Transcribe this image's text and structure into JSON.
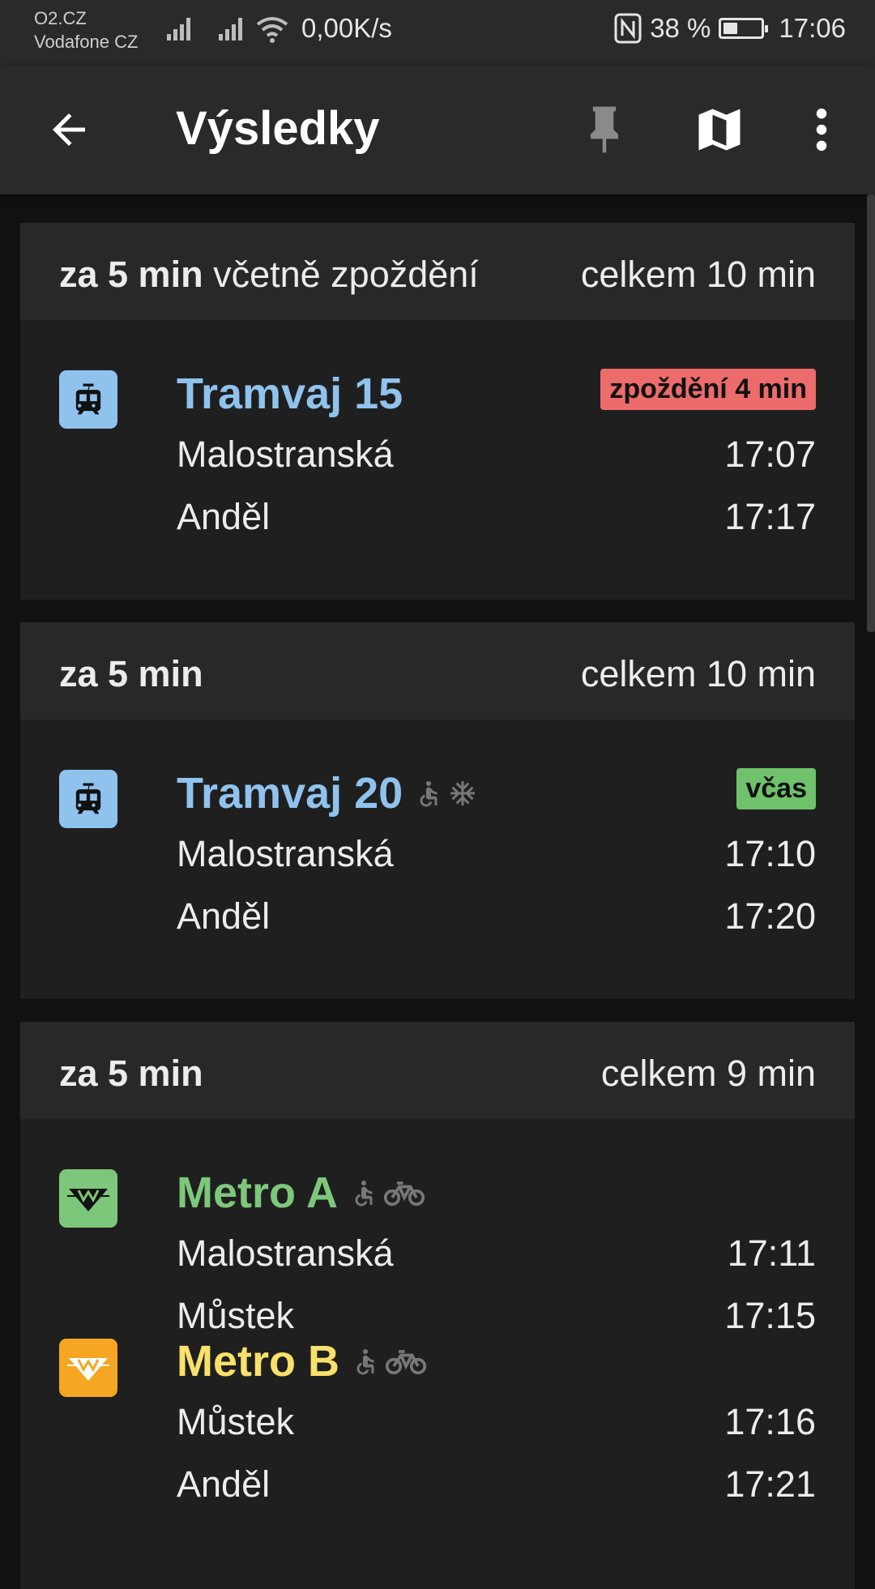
{
  "status_bar": {
    "carrier1": "O2.CZ",
    "carrier2": "Vodafone CZ",
    "net_speed": "0,00K/s",
    "battery_text": "38 %",
    "battery_level": 0.38,
    "clock": "17:06"
  },
  "app_bar": {
    "title": "Výsledky",
    "icons": [
      "arrow-back-icon",
      "pin-icon",
      "map-icon",
      "more-vert-icon"
    ]
  },
  "colors": {
    "tram": "#90c2ee",
    "metro_a": "#7dc77a",
    "metro_b": "#f8e16a",
    "metro_b_icon_bg": "#f5a623",
    "delay_badge": "#ec6b6b",
    "ontime_badge": "#6fc26b"
  },
  "results": [
    {
      "depart_bold": "za 5 min",
      "depart_extra": "včetně zpoždění",
      "total": "celkem 10 min",
      "legs": [
        {
          "icon": "tram-icon",
          "line": "Tramvaj 15",
          "features": [],
          "status": "zpoždění 4 min",
          "from_stop": "Malostranská",
          "from_time": "17:07",
          "to_stop": "Anděl",
          "to_time": "17:17"
        }
      ]
    },
    {
      "depart_bold": "za 5 min",
      "depart_extra": "",
      "total": "celkem 10 min",
      "legs": [
        {
          "icon": "tram-icon",
          "line": "Tramvaj 20",
          "features": [
            "wheelchair-icon",
            "snowflake-icon"
          ],
          "status": "včas",
          "from_stop": "Malostranská",
          "from_time": "17:10",
          "to_stop": "Anděl",
          "to_time": "17:20"
        }
      ]
    },
    {
      "depart_bold": "za 5 min",
      "depart_extra": "",
      "total": "celkem 9 min",
      "legs": [
        {
          "icon": "metro-icon",
          "line": "Metro A",
          "features": [
            "wheelchair-icon",
            "bicycle-icon"
          ],
          "status": "",
          "from_stop": "Malostranská",
          "from_time": "17:11",
          "to_stop": "Můstek",
          "to_time": "17:15"
        },
        {
          "icon": "metro-icon",
          "line": "Metro B",
          "features": [
            "wheelchair-icon",
            "bicycle-icon"
          ],
          "status": "",
          "from_stop": "Můstek",
          "from_time": "17:16",
          "to_stop": "Anděl",
          "to_time": "17:21"
        }
      ]
    }
  ]
}
